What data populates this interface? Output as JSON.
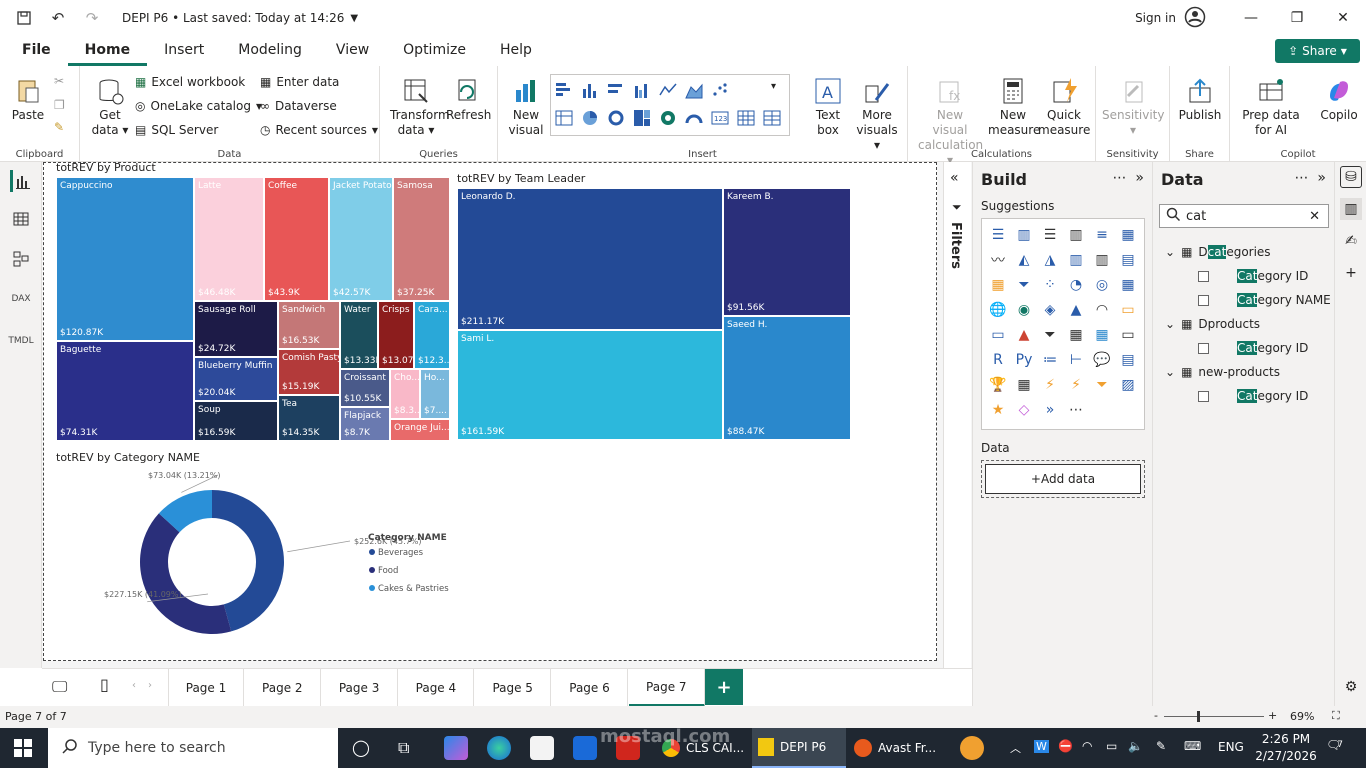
{
  "titlebar": {
    "title": "DEPI P6 • Last saved: Today at 14:26",
    "signin": "Sign in"
  },
  "menu": {
    "items": [
      "File",
      "Home",
      "Insert",
      "Modeling",
      "View",
      "Optimize",
      "Help"
    ],
    "active": "Home",
    "share": "Share"
  },
  "ribbon": {
    "clipboard": {
      "paste": "Paste",
      "label": "Clipboard"
    },
    "data": {
      "get_data": "Get data",
      "excel": "Excel workbook",
      "onelake": "OneLake catalog",
      "sql": "SQL Server",
      "enter": "Enter data",
      "dataverse": "Dataverse",
      "recent": "Recent sources",
      "label": "Data"
    },
    "queries": {
      "transform": "Transform data",
      "refresh": "Refresh",
      "label": "Queries"
    },
    "insert": {
      "new_visual": "New visual",
      "text_box": "Text box",
      "more_visuals": "More visuals",
      "label": "Insert"
    },
    "calculations": {
      "new_visual_calc": "New visual calculation",
      "new_measure": "New measure",
      "quick_measure": "Quick measure",
      "label": "Calculations"
    },
    "sensitivity": {
      "btn": "Sensitivity",
      "label": "Sensitivity"
    },
    "share": {
      "publish": "Publish",
      "label": "Share"
    },
    "copilot": {
      "prep": "Prep data for AI",
      "copilot": "Copilo",
      "label": "Copilot"
    }
  },
  "visuals": {
    "product": {
      "title": "totREV by Product",
      "tiles": [
        {
          "name": "Cappuccino",
          "value": "$120.87K",
          "color": "#2f8ccf"
        },
        {
          "name": "Baguette",
          "value": "$74.31K",
          "color": "#2a2f8a"
        },
        {
          "name": "Latte",
          "value": "$46.48K",
          "color": "#fbd0dc"
        },
        {
          "name": "Coffee",
          "value": "$43.9K",
          "color": "#e85656"
        },
        {
          "name": "Jacket Potato",
          "value": "$42.57K",
          "color": "#7fcde8"
        },
        {
          "name": "Samosa",
          "value": "$37.25K",
          "color": "#cf7b7b"
        },
        {
          "name": "Sausage Roll",
          "value": "$24.72K",
          "color": "#1d1b47"
        },
        {
          "name": "Blueberry Muffin",
          "value": "$20.04K",
          "color": "#2d4a9a"
        },
        {
          "name": "Soup",
          "value": "$16.59K",
          "color": "#1a2a4a"
        },
        {
          "name": "Sandwich",
          "value": "$16.53K",
          "color": "#c47777"
        },
        {
          "name": "Comish Pasty",
          "value": "$15.19K",
          "color": "#b33a3a"
        },
        {
          "name": "Tea",
          "value": "$14.35K",
          "color": "#1d4060"
        },
        {
          "name": "Water",
          "value": "$13.33K",
          "color": "#1b4e5c"
        },
        {
          "name": "Crisps",
          "value": "$13.07K",
          "color": "#8c1d1d"
        },
        {
          "name": "Cara...",
          "value": "$12.3...",
          "color": "#2aa8d8"
        },
        {
          "name": "Croissant",
          "value": "$10.55K",
          "color": "#4a5a8a"
        },
        {
          "name": "Flapjack",
          "value": "$8.7K",
          "color": "#6a7ab0"
        },
        {
          "name": "Cho...",
          "value": "$8.3...",
          "color": "#f9b8c8"
        },
        {
          "name": "Ho...",
          "value": "$7....",
          "color": "#7ab8dc"
        },
        {
          "name": "Orange Jui...",
          "value": "",
          "color": "#e86a6a"
        }
      ]
    },
    "leader": {
      "title": "totREV by Team Leader",
      "tiles": [
        {
          "name": "Leonardo D.",
          "value": "$211.17K",
          "color": "#234a96"
        },
        {
          "name": "Kareem B.",
          "value": "$91.56K",
          "color": "#2a2f7a"
        },
        {
          "name": "Sami L.",
          "value": "$161.59K",
          "color": "#2cb8dc"
        },
        {
          "name": "Saeed H.",
          "value": "$88.47K",
          "color": "#2a88cc"
        }
      ]
    },
    "category": {
      "title": "totREV by Category NAME",
      "legend_title": "Category NAME",
      "labels": [
        "$73.04K (13.21%)",
        "$252.6K (45.7%)",
        "$227.15K (41.09%)"
      ]
    }
  },
  "chart_data": {
    "type": "pie",
    "title": "totREV by Category NAME",
    "categories": [
      "Beverages",
      "Food",
      "Cakes & Pastries"
    ],
    "values": [
      252.6,
      227.15,
      73.04
    ],
    "colors": [
      "#234a96",
      "#2a2f7a",
      "#2a90d8"
    ],
    "legend": "right",
    "donut": true
  },
  "filters": {
    "label": "Filters"
  },
  "build": {
    "title": "Build",
    "suggestions": "Suggestions",
    "data_label": "Data",
    "add_data": "+Add data"
  },
  "datapane": {
    "title": "Data",
    "search_value": "cat",
    "tables": [
      {
        "name": "Dcategories",
        "fields": [
          "Category ID",
          "Category NAME"
        ]
      },
      {
        "name": "Dproducts",
        "fields": [
          "Category ID"
        ]
      },
      {
        "name": "new-products",
        "fields": [
          "Category ID"
        ]
      }
    ]
  },
  "pages": [
    "Page 1",
    "Page 2",
    "Page 3",
    "Page 4",
    "Page 5",
    "Page 6",
    "Page 7"
  ],
  "status": {
    "page": "Page 7 of 7",
    "zoom": "69%"
  },
  "taskbar": {
    "search": "Type here to search",
    "apps": [
      "CLS CAI...",
      "DEPI P6",
      "Avast Fr..."
    ],
    "lang": "ENG",
    "time": "2:26 PM",
    "date": "2/27/2026",
    "notif": "7"
  },
  "watermark": "mostaql.com"
}
